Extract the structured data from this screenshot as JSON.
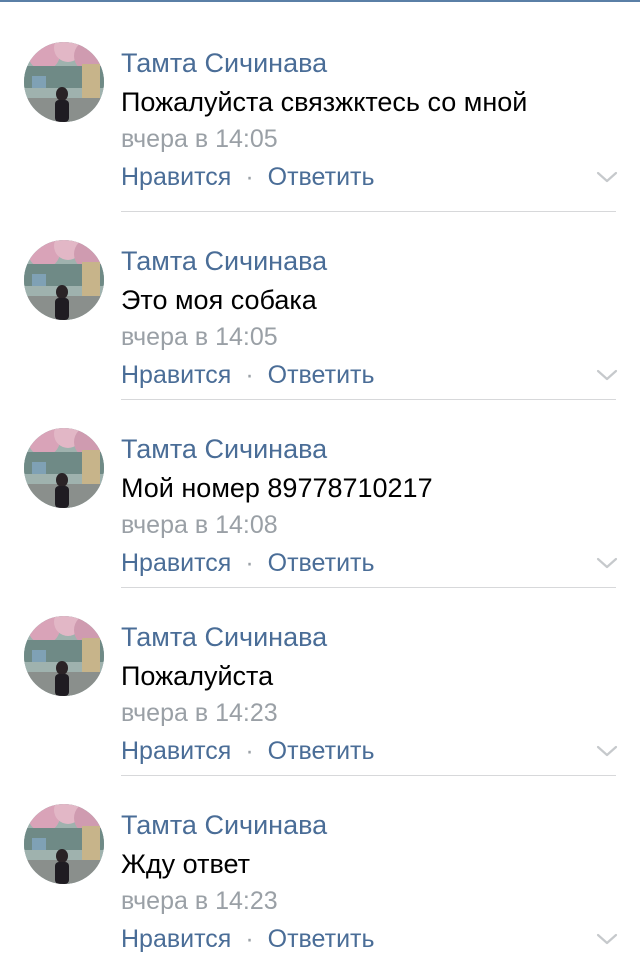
{
  "comments": [
    {
      "author": "Тамта Сичинава",
      "text": "Пожалуйста связжктесь со мной",
      "time": "вчера в 14:05",
      "like_label": "Нравится",
      "reply_label": "Ответить",
      "separator": "·",
      "menu_icon": "chevron-down-icon",
      "avatar_icon": "avatar-photo"
    },
    {
      "author": "Тамта Сичинава",
      "text": "Это моя собака",
      "time": "вчера в 14:05",
      "like_label": "Нравится",
      "reply_label": "Ответить",
      "separator": "·",
      "menu_icon": "chevron-down-icon",
      "avatar_icon": "avatar-photo"
    },
    {
      "author": "Тамта Сичинава",
      "text": "Мой номер 89778710217",
      "time": "вчера в 14:08",
      "like_label": "Нравится",
      "reply_label": "Ответить",
      "separator": "·",
      "menu_icon": "chevron-down-icon",
      "avatar_icon": "avatar-photo"
    },
    {
      "author": "Тамта Сичинава",
      "text": "Пожалуйста",
      "time": "вчера в 14:23",
      "like_label": "Нравится",
      "reply_label": "Ответить",
      "separator": "·",
      "menu_icon": "chevron-down-icon",
      "avatar_icon": "avatar-photo"
    },
    {
      "author": "Тамта Сичинава",
      "text": "Жду ответ",
      "time": "вчера в 14:23",
      "like_label": "Нравится",
      "reply_label": "Ответить",
      "separator": "·",
      "menu_icon": "chevron-down-icon",
      "avatar_icon": "avatar-photo"
    }
  ],
  "colors": {
    "link": "#4a6d97",
    "text": "#000000",
    "muted": "#9aa0a6",
    "divider": "#d7d8da",
    "top_bar": "#5a7fa6"
  }
}
